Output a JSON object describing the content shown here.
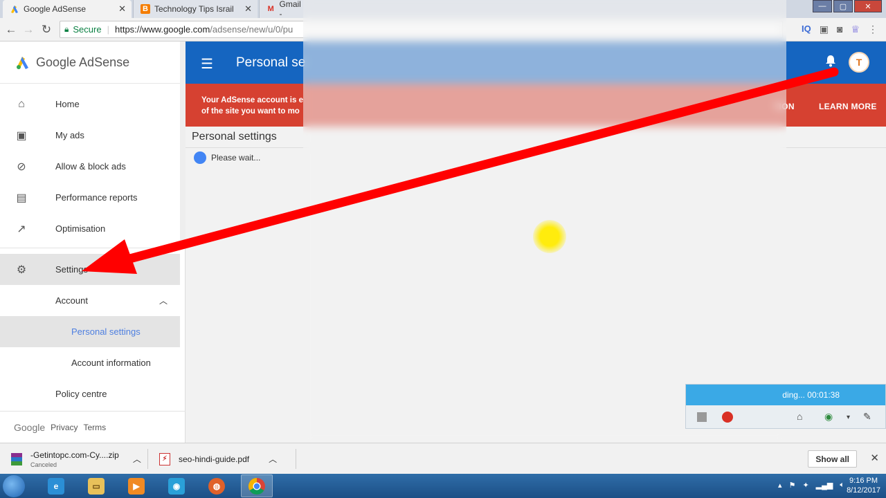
{
  "browser": {
    "tabs": [
      {
        "title": "Google AdSense",
        "close": "✕"
      },
      {
        "title": "Technology Tips Israil",
        "close": "✕"
      },
      {
        "title": "Gmail -",
        "close": ""
      }
    ],
    "secure_label": "Secure",
    "url_host": "https://www.google.com",
    "url_path": "/adsense/new/u/0/pu",
    "ext_iq": "IQ"
  },
  "sidebar": {
    "brand": "Google AdSense",
    "items": [
      {
        "label": "Home"
      },
      {
        "label": "My ads"
      },
      {
        "label": "Allow & block ads"
      },
      {
        "label": "Performance reports"
      },
      {
        "label": "Optimisation"
      },
      {
        "label": "Settings"
      },
      {
        "label": "Account"
      },
      {
        "label": "Personal settings"
      },
      {
        "label": "Account information"
      },
      {
        "label": "Policy centre"
      }
    ],
    "footer": {
      "google": "Google",
      "privacy": "Privacy",
      "terms": "Terms"
    }
  },
  "appbar": {
    "title": "Personal se",
    "avatar_letter": "T"
  },
  "banner": {
    "line1": "Your AdSense account is e",
    "line2": "of the site you want to mo",
    "action1": "TION",
    "action2": "LEARN MORE"
  },
  "content": {
    "title": "Personal settings",
    "loading": "Please wait..."
  },
  "recorder": {
    "status": "ding... 00:01:38"
  },
  "downloads": {
    "items": [
      {
        "name": "-Getintopc.com-Cy....zip",
        "status": "Canceled"
      },
      {
        "name": "seo-hindi-guide.pdf",
        "status": ""
      }
    ],
    "show_all": "Show all"
  },
  "taskbar": {
    "time": "9:16 PM",
    "date": "8/12/2017"
  },
  "colors": {
    "appbar": "#1565c0",
    "banner": "#d64131",
    "arrow": "#ff0000",
    "link_active": "#4e7fe0"
  }
}
